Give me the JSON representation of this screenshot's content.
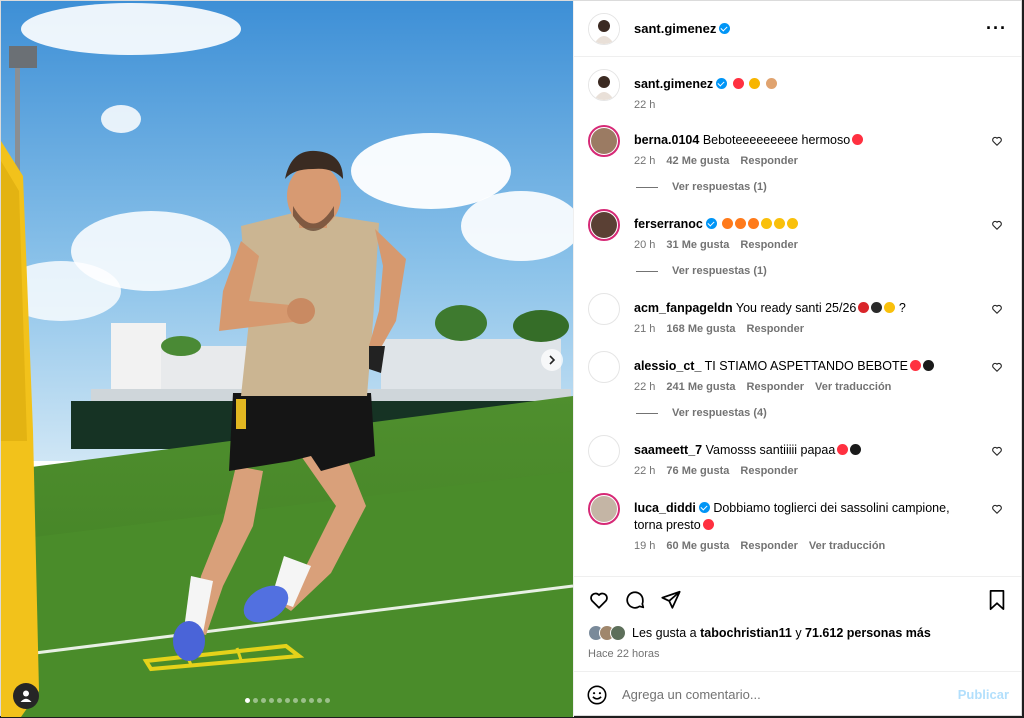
{
  "post": {
    "author": "sant.gimenez",
    "caption_emojis": [
      "❤️",
      "😤",
      "💪"
    ],
    "caption_time": "22 h",
    "media_dots": 11,
    "active_dot": 0
  },
  "comments": [
    {
      "user": "berna.0104",
      "verified": false,
      "text": "Beboteeeeeeeee hermoso",
      "emojis": [
        "heart"
      ],
      "time": "22 h",
      "likes": "42 Me gusta",
      "reply": "Responder",
      "translate": "",
      "replies": "Ver respuestas (1)"
    },
    {
      "user": "ferserranoc",
      "verified": true,
      "text": "",
      "emojis": [
        "fire",
        "fire",
        "fire",
        "hearteyes",
        "hearteyes",
        "hearteyes"
      ],
      "time": "20 h",
      "likes": "31 Me gusta",
      "reply": "Responder",
      "translate": "",
      "replies": "Ver respuestas (1)"
    },
    {
      "user": "acm_fanpageldn",
      "verified": false,
      "text": "You ready santi 25/26",
      "emojis": [
        "red",
        "black",
        "wink",
        "?"
      ],
      "time": "21 h",
      "likes": "168 Me gusta",
      "reply": "Responder",
      "translate": "",
      "replies": ""
    },
    {
      "user": "alessio_ct_",
      "verified": false,
      "text": "TI STIAMO ASPETTANDO BEBOTE",
      "emojis": [
        "heart",
        "blackheart"
      ],
      "time": "22 h",
      "likes": "241 Me gusta",
      "reply": "Responder",
      "translate": "Ver traducción",
      "replies": "Ver respuestas (4)"
    },
    {
      "user": "saameett_7",
      "verified": false,
      "text": "Vamosss santiiiii papaa",
      "emojis": [
        "heart",
        "blackheart"
      ],
      "time": "22 h",
      "likes": "76 Me gusta",
      "reply": "Responder",
      "translate": "",
      "replies": ""
    },
    {
      "user": "luca_diddi",
      "verified": true,
      "text": "Dobbiamo toglierci dei sassolini campione, torna presto",
      "emojis": [
        "heart"
      ],
      "time": "19 h",
      "likes": "60 Me gusta",
      "reply": "Responder",
      "translate": "Ver traducción",
      "replies": ""
    }
  ],
  "actions": {
    "likes_prefix": "Les gusta a",
    "likes_user": "tabochristian11",
    "likes_conj": "y",
    "likes_count": "71.612 personas más",
    "posted_ago": "Hace 22 horas"
  },
  "composer": {
    "placeholder": "Agrega un comentario...",
    "publish": "Publicar"
  },
  "icons": [
    "more-options-icon",
    "heart-icon",
    "comment-icon",
    "share-icon",
    "bookmark-icon",
    "emoji-icon",
    "next-arrow-icon",
    "tagged-user-icon"
  ],
  "colors": {
    "accent": "#0095f6",
    "publish_disabled": "#b2dffc",
    "like_red": "#ff3040",
    "muted": "#737373"
  }
}
